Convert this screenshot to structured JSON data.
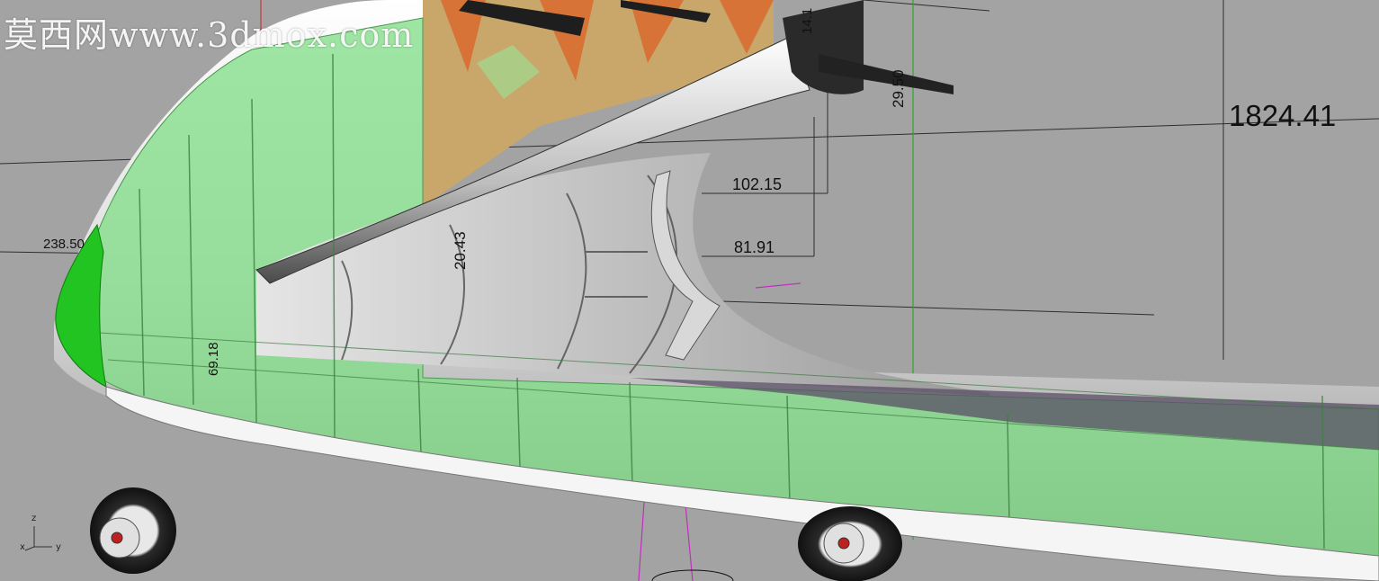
{
  "watermark": "莫西网www.3dmox.com",
  "dimensions": {
    "d1": "1824.41",
    "d2": "102.15",
    "d3": "81.91",
    "d4": "238.50",
    "d5": "69.18",
    "d6": "20.43",
    "d7": "29.50",
    "d8": "14.1"
  },
  "axes": {
    "z": "z",
    "x": "x",
    "y": "y"
  },
  "colors": {
    "background": "#a3a3a3",
    "panel_green": "#7fdc84",
    "nose_green": "#22c422",
    "skin": "#f2f2f2",
    "wing_orange": "#d96a2e"
  }
}
